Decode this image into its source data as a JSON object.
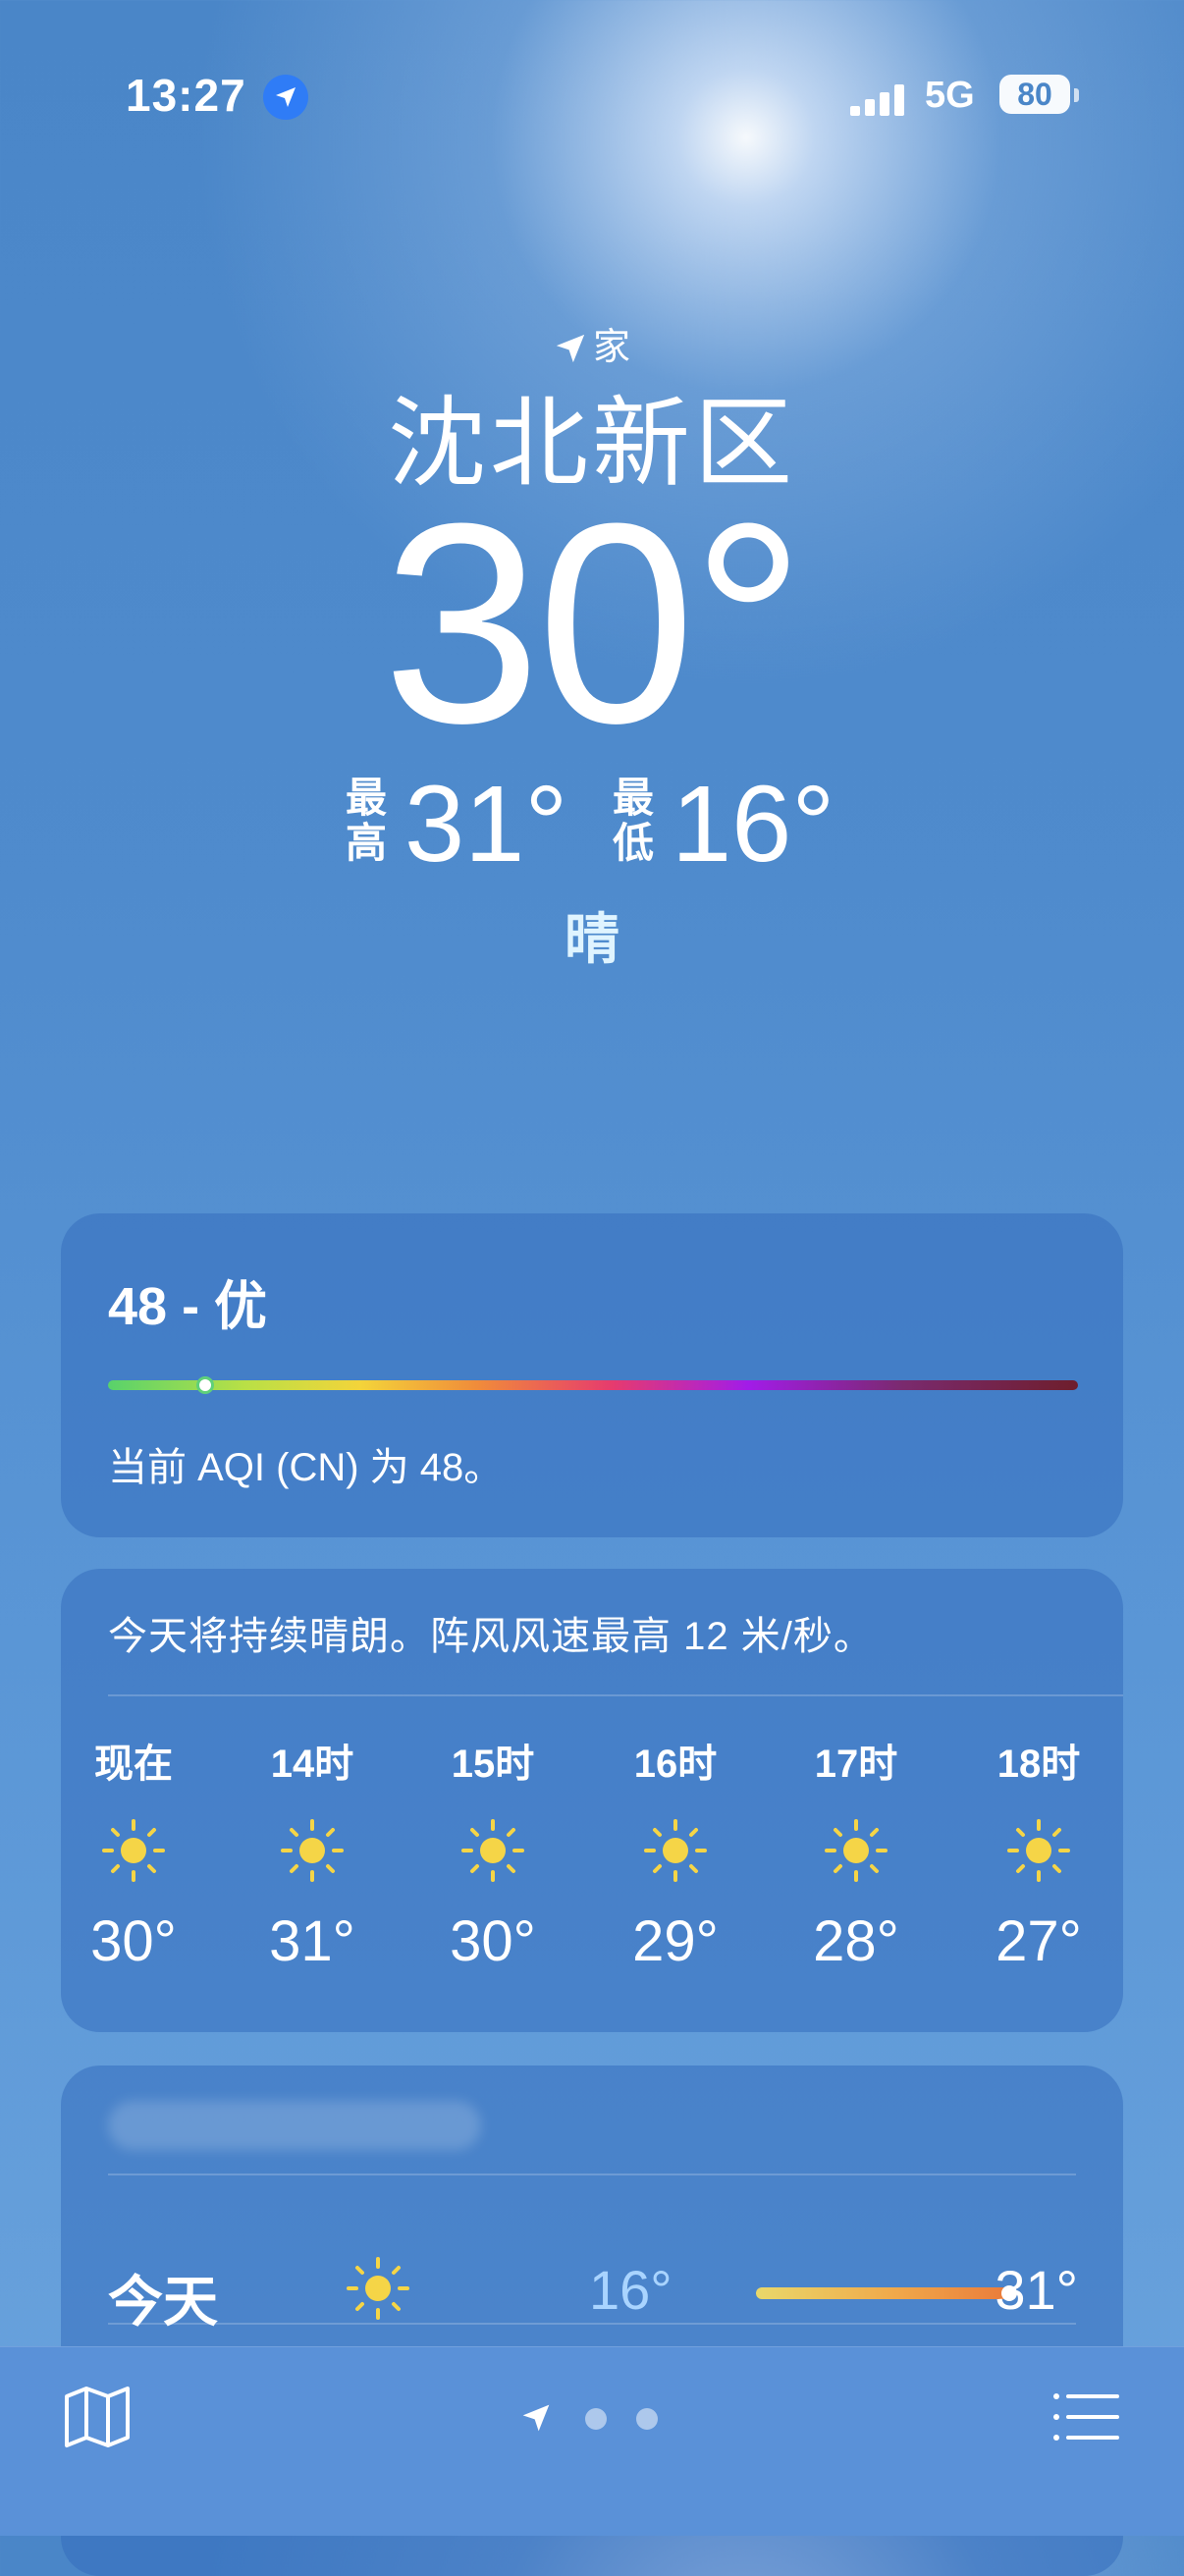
{
  "status_bar": {
    "time": "13:27",
    "network": "5G",
    "battery": "80"
  },
  "location": {
    "tag": "家",
    "city": "沈北新区"
  },
  "current": {
    "temperature": "30°",
    "high_label": "最高",
    "high": "31°",
    "low_label": "最低",
    "low": "16°",
    "condition": "晴"
  },
  "aqi": {
    "value_text": "48 - 优",
    "description": "当前 AQI (CN) 为 48。",
    "indicator_position": 0.1
  },
  "hourly": {
    "summary": "今天将持续晴朗。阵风风速最高 12 米/秒。",
    "hours": [
      {
        "label": "现在",
        "icon": "sun-icon",
        "temp": "30°"
      },
      {
        "label": "14时",
        "icon": "sun-icon",
        "temp": "31°"
      },
      {
        "label": "15时",
        "icon": "sun-icon",
        "temp": "30°"
      },
      {
        "label": "16时",
        "icon": "sun-icon",
        "temp": "29°"
      },
      {
        "label": "17时",
        "icon": "sun-icon",
        "temp": "28°"
      },
      {
        "label": "18时",
        "icon": "sun-icon",
        "temp": "27°"
      }
    ]
  },
  "daily": {
    "days": [
      {
        "name": "今天",
        "icon": "sun-icon",
        "low": "16°",
        "high": "31°"
      }
    ]
  },
  "colors": {
    "background": "#4f8bcd",
    "card": "#346ebe",
    "sun": "#f5d547",
    "low_temp": "#a9d4ff",
    "location_dot": "#2f7cf6"
  }
}
